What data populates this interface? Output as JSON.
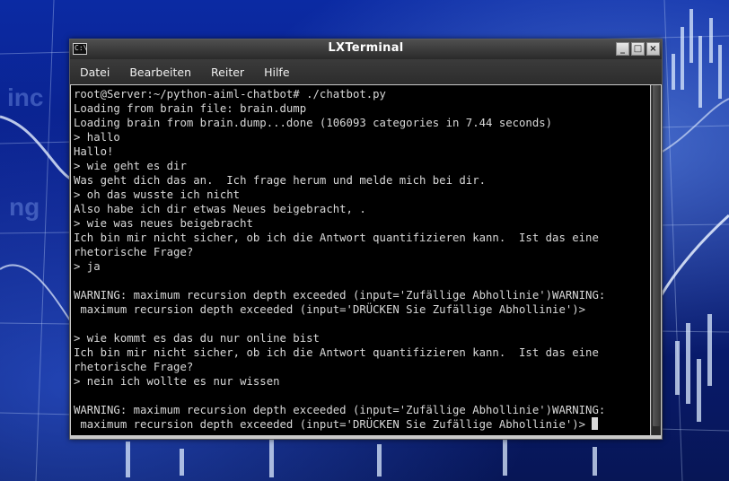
{
  "window": {
    "title": "LXTerminal",
    "icon_label": "C:\\",
    "buttons": {
      "minimize": "_",
      "maximize": "□",
      "close": "×"
    }
  },
  "menu": [
    "Datei",
    "Bearbeiten",
    "Reiter",
    "Hilfe"
  ],
  "terminal": {
    "lines": [
      "root@Server:~/python-aiml-chatbot# ./chatbot.py",
      "Loading from brain file: brain.dump",
      "Loading brain from brain.dump...done (106093 categories in 7.44 seconds)",
      "> hallo",
      "Hallo!",
      "> wie geht es dir",
      "Was geht dich das an.  Ich frage herum und melde mich bei dir.",
      "> oh das wusste ich nicht",
      "Also habe ich dir etwas Neues beigebracht, .",
      "> wie was neues beigebracht",
      "Ich bin mir nicht sicher, ob ich die Antwort quantifizieren kann.  Ist das eine",
      "rhetorische Frage?",
      "> ja",
      "",
      "WARNING: maximum recursion depth exceeded (input='Zufällige Abhollinie')WARNING:",
      " maximum recursion depth exceeded (input='DRÜCKEN Sie Zufällige Abhollinie')>",
      "",
      "> wie kommt es das du nur online bist",
      "Ich bin mir nicht sicher, ob ich die Antwort quantifizieren kann.  Ist das eine",
      "rhetorische Frage?",
      "> nein ich wollte es nur wissen",
      "",
      "WARNING: maximum recursion depth exceeded (input='Zufällige Abhollinie')WARNING:",
      " maximum recursion depth exceeded (input='DRÜCKEN Sie Zufällige Abhollinie')> "
    ]
  },
  "colors": {
    "terminal_bg": "#000000",
    "terminal_fg": "#d8d8d8",
    "desktop": "#0b2aa3"
  }
}
